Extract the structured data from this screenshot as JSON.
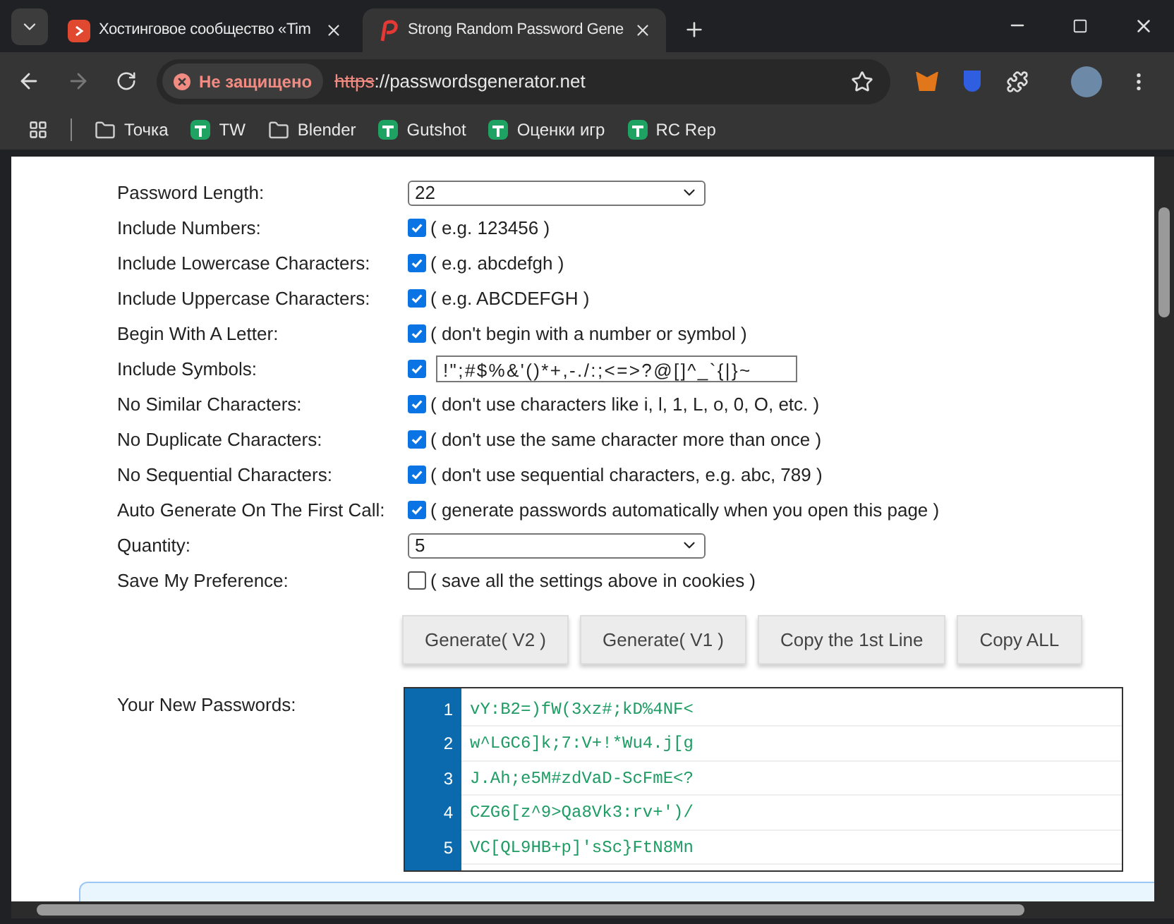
{
  "browser": {
    "tabs": [
      {
        "title": "Хостинговое сообщество «Tim",
        "selected": false
      },
      {
        "title": "Strong Random Password Gene",
        "selected": true
      }
    ],
    "security": "Не защищено",
    "url_scheme": "https",
    "url_rest": "://passwordsgenerator.net",
    "bookmarks": [
      {
        "kind": "folder",
        "label": "Точка"
      },
      {
        "kind": "sheet",
        "label": "TW"
      },
      {
        "kind": "folder",
        "label": "Blender"
      },
      {
        "kind": "sheet",
        "label": "Gutshot"
      },
      {
        "kind": "sheet",
        "label": "Оценки игр"
      },
      {
        "kind": "sheet",
        "label": "RC Rep"
      }
    ]
  },
  "options": [
    {
      "kind": "select",
      "label": "Password Length:",
      "value": "22"
    },
    {
      "kind": "check",
      "label": "Include Numbers:",
      "checked": true,
      "note": "( e.g. 123456 )"
    },
    {
      "kind": "check",
      "label": "Include Lowercase Characters:",
      "checked": true,
      "note": "( e.g. abcdefgh )"
    },
    {
      "kind": "check",
      "label": "Include Uppercase Characters:",
      "checked": true,
      "note": "( e.g. ABCDEFGH )"
    },
    {
      "kind": "check",
      "label": "Begin With A Letter:",
      "checked": true,
      "note": "( don't begin with a number or symbol )"
    },
    {
      "kind": "check_input",
      "label": "Include Symbols:",
      "checked": true,
      "value": "!\";#$%&'()*+,-./:;<=>?@[]^_`{|}~"
    },
    {
      "kind": "check",
      "label": "No Similar Characters:",
      "checked": true,
      "note": "( don't use characters like i, l, 1, L, o, 0, O, etc. )"
    },
    {
      "kind": "check",
      "label": "No Duplicate Characters:",
      "checked": true,
      "note": "( don't use the same character more than once )"
    },
    {
      "kind": "check",
      "label": "No Sequential Characters:",
      "checked": true,
      "note": "( don't use sequential characters, e.g. abc, 789 )"
    },
    {
      "kind": "check",
      "label": "Auto Generate On The First Call:",
      "checked": true,
      "note": "( generate passwords automatically when you open this page )"
    },
    {
      "kind": "select",
      "label": "Quantity:",
      "value": "5"
    },
    {
      "kind": "check",
      "label": "Save My Preference:",
      "checked": false,
      "note": "( save all the settings above in cookies )"
    }
  ],
  "buttons": [
    "Generate( V2 )",
    "Generate( V1 )",
    "Copy the 1st Line",
    "Copy ALL"
  ],
  "result_label": "Your New Passwords:",
  "passwords": [
    {
      "number": "1",
      "text": "vY:B2=)fW(3xz#;kD%4NF<"
    },
    {
      "number": "2",
      "text": "w^LGC6]k;7:V+!*Wu4.j[g"
    },
    {
      "number": "3",
      "text": "J.Ah;e5M#zdVaD-ScFmE<?"
    },
    {
      "number": "4",
      "text": "CZG6[z^9>Qa8Vk3:rv+')/"
    },
    {
      "number": "5",
      "text": "VC[QL9HB+p]'sSc}FtN8Mn"
    }
  ]
}
